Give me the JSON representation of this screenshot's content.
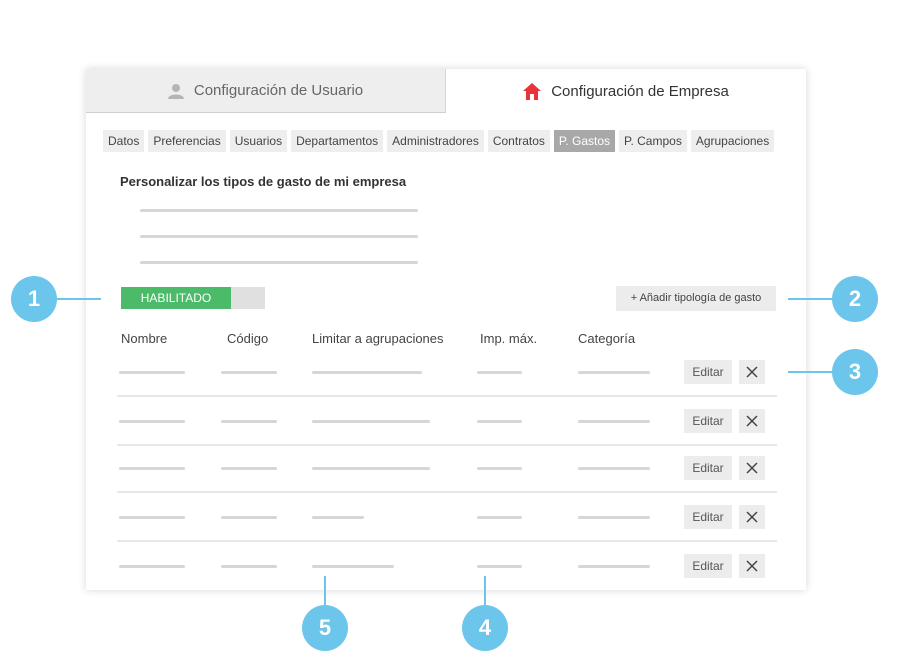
{
  "header": {
    "user_tab": "Configuración de Usuario",
    "company_tab": "Configuración de Empresa",
    "company_icon_color": "#e8333a"
  },
  "subtabs": [
    "Datos",
    "Preferencias",
    "Usuarios",
    "Departamentos",
    "Administradores",
    "Contratos",
    "P. Gastos",
    "P. Campos",
    "Agrupaciones"
  ],
  "active_subtab": "P. Gastos",
  "section": {
    "title": "Personalizar los tipos de gasto de mi empresa"
  },
  "toggle": {
    "label": "HABILITADO",
    "color": "#4cbb69"
  },
  "add_button": "+ Añadir tipología de gasto",
  "table": {
    "headers": [
      "Nombre",
      "Código",
      "Limitar a agrupaciones",
      "Imp. máx.",
      "Categoría"
    ],
    "edit_label": "Editar"
  },
  "callouts": [
    "1",
    "2",
    "3",
    "4",
    "5"
  ],
  "colors": {
    "callout": "#6cc5ea",
    "accent_green": "#4cbb69"
  }
}
